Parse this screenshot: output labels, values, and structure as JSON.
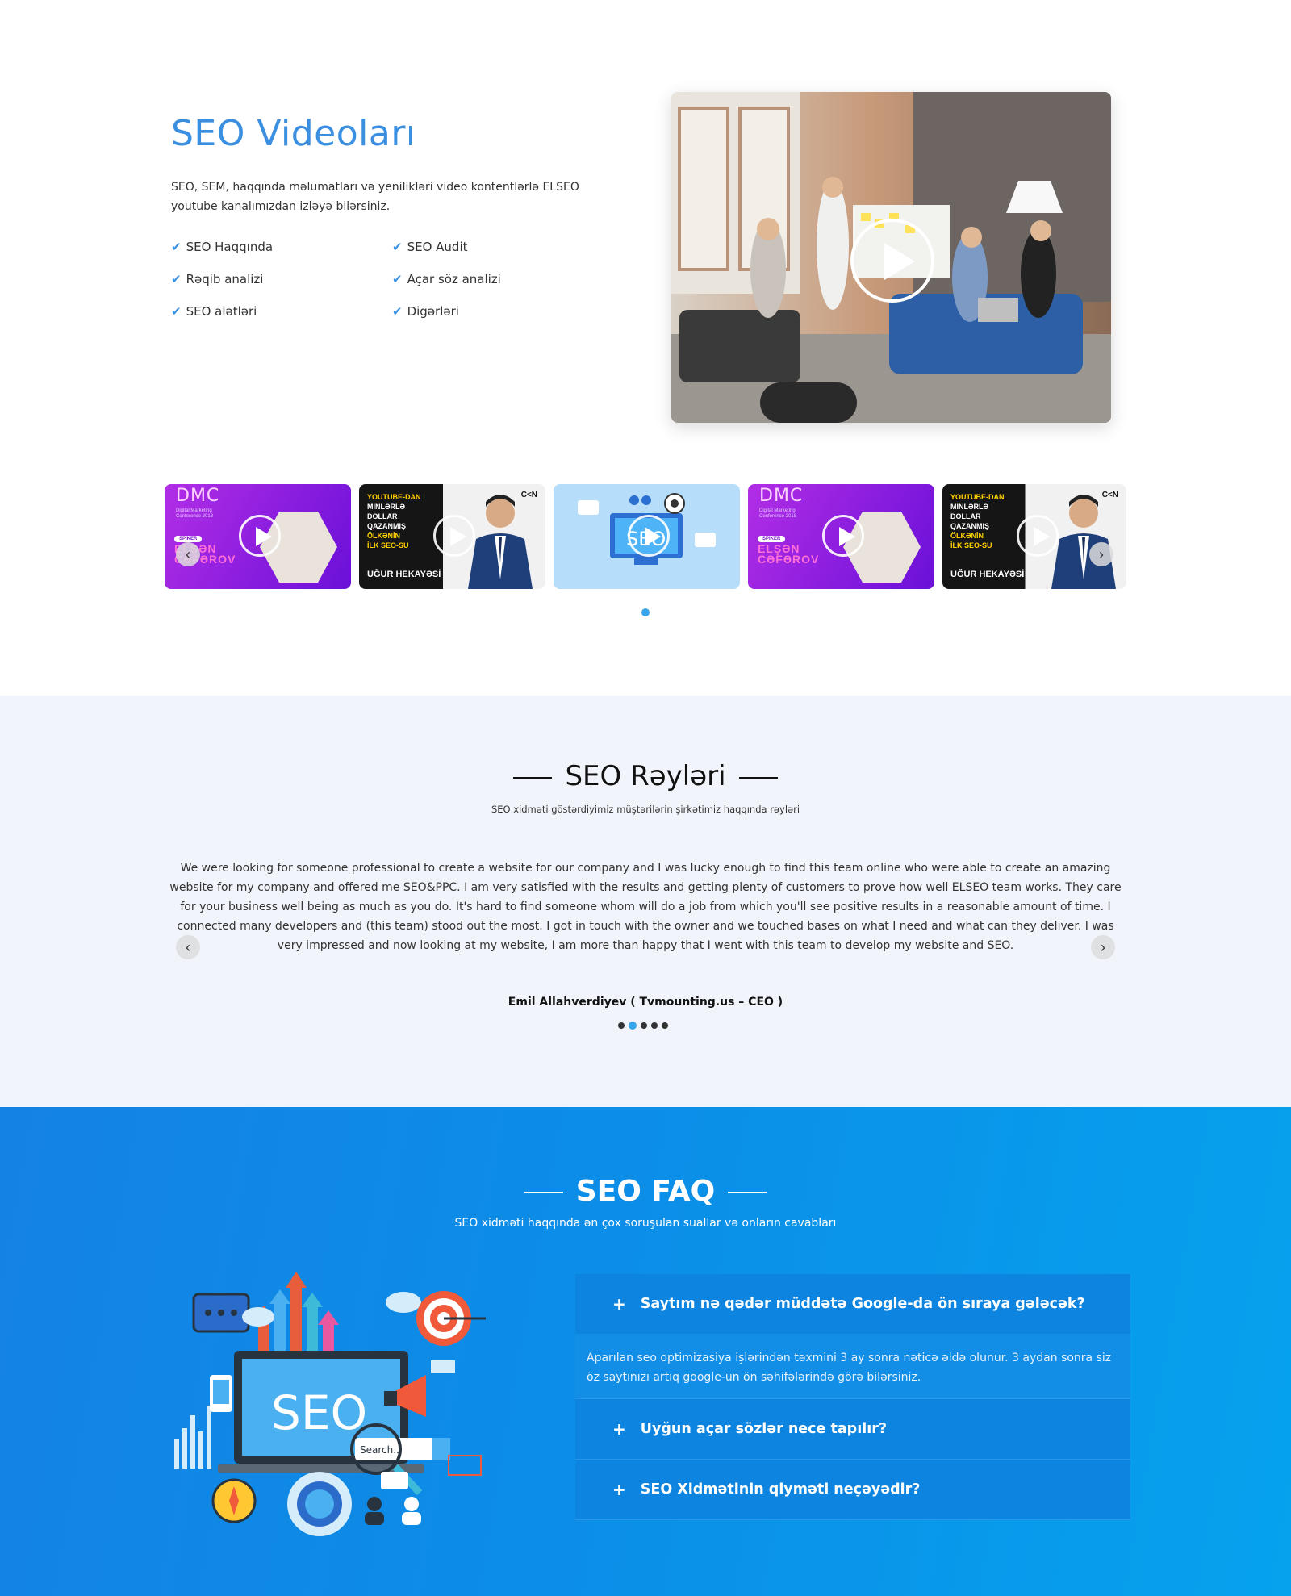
{
  "videos": {
    "title": "SEO Videoları",
    "description": "SEO, SEM, haqqında məlumatları və yenilikləri video kontentlərlə ELSEO youtube kanalımızdan izləyə bilərsiniz.",
    "features": [
      "SEO Haqqında",
      "SEO Audit",
      "Rəqib analizi",
      "Açar söz analizi",
      "SEO alətləri",
      "Digərləri"
    ],
    "thumbs": {
      "dmc_title": "DMC",
      "dmc_sub": "Digital Marketing Conference 2018",
      "speaker_tag": "SPİKER",
      "speaker_name_1": "ELŞƏN",
      "speaker_name_2": "CƏFƏROV",
      "yt_line1": "YOUTUBE-DAN",
      "yt_line2": "MİNLƏRLƏ",
      "yt_line3": "DOLLAR",
      "yt_line4": "QAZANMIŞ",
      "yt_line5": "ÖLKƏNİN",
      "yt_line6": "İLK SEO-SU",
      "yt_bottom": "UĞUR HEKAYƏSİ",
      "cn_logo": "C<N",
      "seo_text": "SEO"
    }
  },
  "reviews": {
    "title": "SEO Rəyləri",
    "subtitle": "SEO xidməti göstərdiyimiz müştərilərin şirkətimiz haqqında rəyləri",
    "text": "We were looking for someone professional to create a website for our company and I was lucky enough to find this team online who were able to create an amazing website for my company and offered me SEO&PPC. I am very satisfied with the results and getting plenty of customers to prove how well ELSEO team works. They care for your business well being as much as you do. It's hard to find someone whom will do a job from which you'll see positive results in a reasonable amount of time. I connected many developers and (this team) stood out the most. I got in touch with the owner and we touched bases on what I need and what can they deliver. I was very impressed and now looking at my website, I am more than happy that I went with this team to develop my website and SEO.",
    "author": "Emil Allahverdiyev ( Tvmounting.us – CEO )"
  },
  "faq": {
    "title": "SEO FAQ",
    "subtitle": "SEO xidməti haqqında ən çox soruşulan suallar və onların cavabları",
    "items": [
      {
        "q": "Saytım nə qədər müddətə Google-da ön sıraya gələcək?",
        "a": "Aparılan seo optimizasiya işlərindən təxmini 3 ay sonra nəticə əldə olunur. 3 aydan sonra siz öz saytınızı artıq google-un ön səhifələrində görə bilərsiniz."
      },
      {
        "q": "Uyğun açar sözlər nece tapılır?"
      },
      {
        "q": "SEO Xidmətinin qiyməti neçəyədir?"
      }
    ],
    "illus_seo": "SEO",
    "illus_search": "Search..."
  },
  "colors": {
    "accent": "#3a8fe0",
    "faq_bg": "#0b8fe8",
    "dot_active": "#3aa5e8"
  }
}
